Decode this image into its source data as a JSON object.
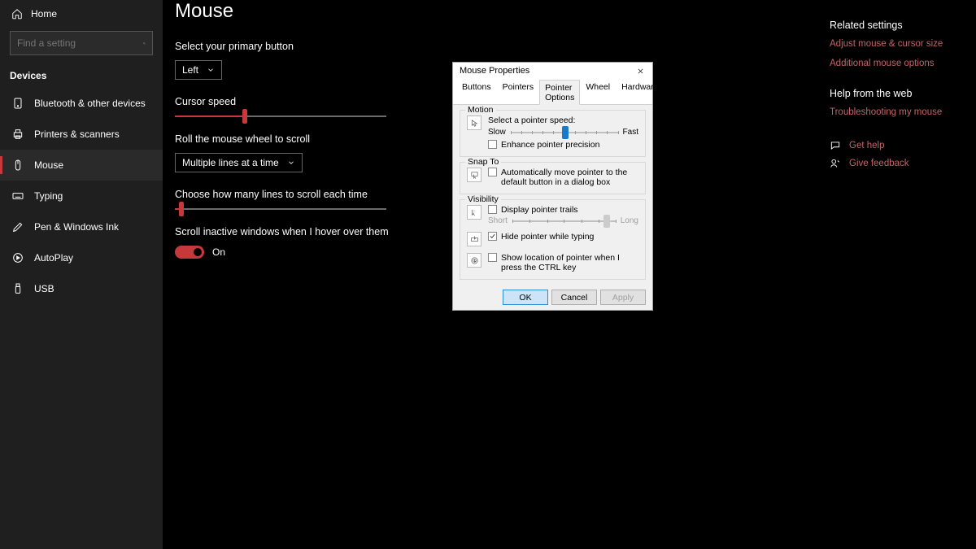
{
  "sidebar": {
    "home": "Home",
    "search_placeholder": "Find a setting",
    "section": "Devices",
    "items": [
      {
        "label": "Bluetooth & other devices"
      },
      {
        "label": "Printers & scanners"
      },
      {
        "label": "Mouse"
      },
      {
        "label": "Typing"
      },
      {
        "label": "Pen & Windows Ink"
      },
      {
        "label": "AutoPlay"
      },
      {
        "label": "USB"
      }
    ]
  },
  "main": {
    "title": "Mouse",
    "primary_btn_label": "Select your primary button",
    "primary_btn_value": "Left",
    "cursor_speed_label": "Cursor speed",
    "roll_label": "Roll the mouse wheel to scroll",
    "roll_value": "Multiple lines at a time",
    "lines_label": "Choose how many lines to scroll each time",
    "hover_label": "Scroll inactive windows when I hover over them",
    "hover_value": "On"
  },
  "right": {
    "h1": "Related settings",
    "link1": "Adjust mouse & cursor size",
    "link2": "Additional mouse options",
    "h2": "Help from the web",
    "link3": "Troubleshooting my mouse",
    "help": "Get help",
    "feedback": "Give feedback"
  },
  "dlg": {
    "title": "Mouse Properties",
    "tabs": [
      "Buttons",
      "Pointers",
      "Pointer Options",
      "Wheel",
      "Hardware"
    ],
    "motion": {
      "group": "Motion",
      "label": "Select a pointer speed:",
      "slow": "Slow",
      "fast": "Fast",
      "enhance": "Enhance pointer precision"
    },
    "snap": {
      "group": "Snap To",
      "label": "Automatically move pointer to the default button in a dialog box"
    },
    "vis": {
      "group": "Visibility",
      "trails": "Display pointer trails",
      "short": "Short",
      "long": "Long",
      "hide": "Hide pointer while typing",
      "ctrl": "Show location of pointer when I press the CTRL key"
    },
    "ok": "OK",
    "cancel": "Cancel",
    "apply": "Apply"
  }
}
